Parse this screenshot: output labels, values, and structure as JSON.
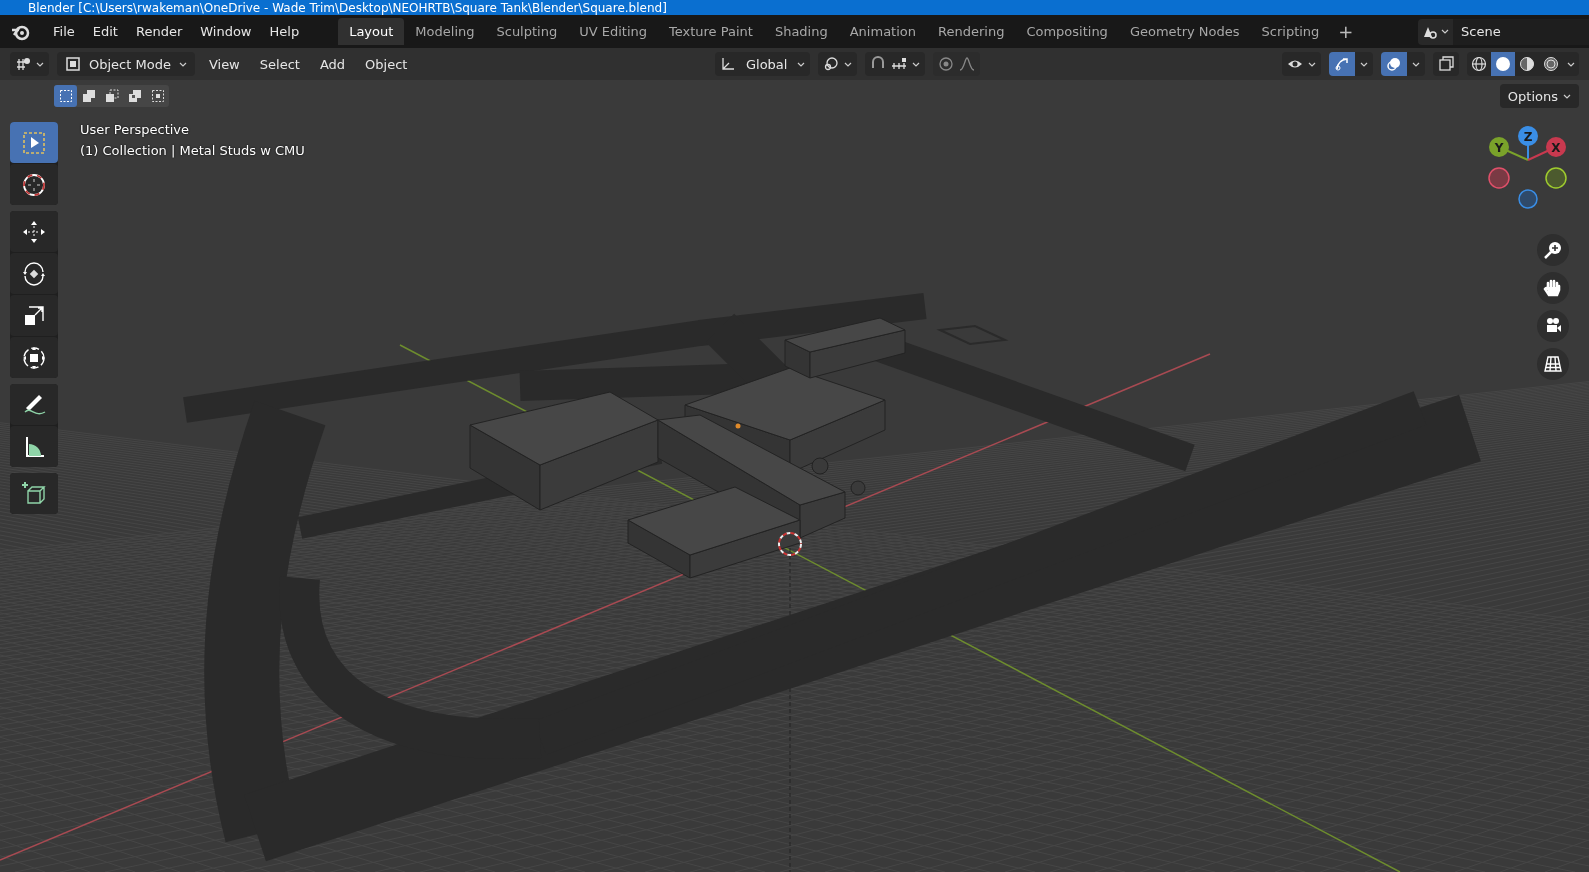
{
  "window": {
    "title": "Blender [C:\\Users\\rwakeman\\OneDrive - Wade Trim\\Desktop\\NEOHRTB\\Square Tank\\Blender\\Square.blend]"
  },
  "menu": [
    "File",
    "Edit",
    "Render",
    "Window",
    "Help"
  ],
  "workspaces": [
    {
      "label": "Layout",
      "selected": true
    },
    {
      "label": "Modeling",
      "selected": false
    },
    {
      "label": "Sculpting",
      "selected": false
    },
    {
      "label": "UV Editing",
      "selected": false
    },
    {
      "label": "Texture Paint",
      "selected": false
    },
    {
      "label": "Shading",
      "selected": false
    },
    {
      "label": "Animation",
      "selected": false
    },
    {
      "label": "Rendering",
      "selected": false
    },
    {
      "label": "Compositing",
      "selected": false
    },
    {
      "label": "Geometry Nodes",
      "selected": false
    },
    {
      "label": "Scripting",
      "selected": false
    }
  ],
  "add_workspace": "+",
  "scene": {
    "name": "Scene"
  },
  "header": {
    "mode": "Object Mode",
    "menus": [
      "View",
      "Select",
      "Add",
      "Object"
    ],
    "orientation": "Global",
    "snap_on": false,
    "proportional_on": false,
    "gizmos_on": true,
    "overlays_on": true,
    "options": "Options"
  },
  "select_modes": [
    {
      "selected": true
    },
    {
      "selected": false
    },
    {
      "selected": false
    },
    {
      "selected": false
    },
    {
      "selected": false
    }
  ],
  "shading_modes": [
    {
      "selected": false
    },
    {
      "selected": true
    },
    {
      "selected": false
    },
    {
      "selected": false
    }
  ],
  "tool_groups": [
    [
      {
        "kind": "select",
        "selected": true
      },
      {
        "kind": "cursor",
        "selected": false
      }
    ],
    [
      {
        "kind": "move",
        "selected": false
      },
      {
        "kind": "rotate",
        "selected": false
      },
      {
        "kind": "scale",
        "selected": false
      },
      {
        "kind": "transform",
        "selected": false
      }
    ],
    [
      {
        "kind": "annotate",
        "selected": false
      },
      {
        "kind": "measure",
        "selected": false
      }
    ],
    [
      {
        "kind": "add-cube",
        "selected": false
      }
    ]
  ],
  "viewport": {
    "view": "User Perspective",
    "collection": "(1) Collection | Metal Studs w CMU"
  },
  "axes": [
    {
      "label": "Z"
    },
    {
      "label": "Y"
    },
    {
      "label": "X"
    }
  ]
}
